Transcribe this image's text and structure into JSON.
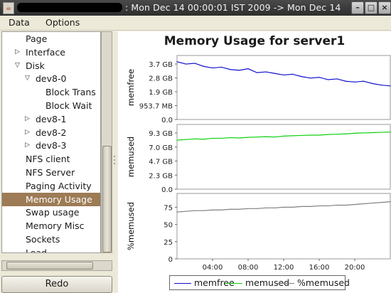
{
  "window": {
    "title": ": Mon Dec 14 00:00:01 IST 2009 -> Mon Dec 14",
    "app_icon": "java-cup-icon",
    "buttons": [
      "minimize-icon",
      "maximize-icon",
      "close-icon"
    ]
  },
  "menu": {
    "items": [
      "Data",
      "Options"
    ]
  },
  "tree": {
    "items": [
      {
        "label": "Page",
        "depth": 1,
        "arrow": ""
      },
      {
        "label": "Interface",
        "depth": 1,
        "arrow": "collapsed"
      },
      {
        "label": "Disk",
        "depth": 1,
        "arrow": "expanded"
      },
      {
        "label": "dev8-0",
        "depth": 2,
        "arrow": "expanded"
      },
      {
        "label": "Block Trans",
        "depth": 3,
        "arrow": ""
      },
      {
        "label": "Block Wait",
        "depth": 3,
        "arrow": ""
      },
      {
        "label": "dev8-1",
        "depth": 2,
        "arrow": "collapsed"
      },
      {
        "label": "dev8-2",
        "depth": 2,
        "arrow": "collapsed"
      },
      {
        "label": "dev8-3",
        "depth": 2,
        "arrow": "collapsed"
      },
      {
        "label": "NFS client",
        "depth": 1,
        "arrow": ""
      },
      {
        "label": "NFS Server",
        "depth": 1,
        "arrow": ""
      },
      {
        "label": "Paging Activity",
        "depth": 1,
        "arrow": ""
      },
      {
        "label": "Memory Usage",
        "depth": 1,
        "arrow": "",
        "selected": true
      },
      {
        "label": "Swap usage",
        "depth": 1,
        "arrow": ""
      },
      {
        "label": "Memory Misc",
        "depth": 1,
        "arrow": ""
      },
      {
        "label": "Sockets",
        "depth": 1,
        "arrow": ""
      },
      {
        "label": "Load",
        "depth": 1,
        "arrow": ""
      }
    ]
  },
  "redo_button": {
    "label": "Redo"
  },
  "chart_data": {
    "type": "line",
    "title": "Memory Usage for server1",
    "x_ticks": [
      "04:00",
      "08:00",
      "12:00",
      "16:00",
      "20:00"
    ],
    "xlim": [
      0,
      24
    ],
    "subplots": [
      {
        "ylabel": "memfree",
        "y_ticks": [
          "3.7 GB",
          "2.8 GB",
          "1.9 GB",
          "953.7 MB",
          "0.0"
        ],
        "ylim": [
          0,
          4.1
        ],
        "series": [
          {
            "name": "memfree",
            "color": "#1010d0",
            "x": [
              0,
              1,
              2,
              3,
              4,
              5,
              6,
              7,
              8,
              9,
              10,
              11,
              12,
              13,
              14,
              15,
              16,
              17,
              18,
              19,
              20,
              21,
              22,
              23,
              24
            ],
            "values": [
              3.7,
              3.55,
              3.6,
              3.4,
              3.3,
              3.35,
              3.2,
              3.15,
              3.25,
              3.0,
              3.05,
              2.95,
              2.85,
              2.9,
              2.75,
              2.65,
              2.7,
              2.55,
              2.6,
              2.45,
              2.4,
              2.45,
              2.3,
              2.2,
              2.15
            ]
          }
        ]
      },
      {
        "ylabel": "memused",
        "y_ticks": [
          "9.3 GB",
          "7.0 GB",
          "4.7 GB",
          "2.3 GB",
          "0.0"
        ],
        "ylim": [
          0,
          10.3
        ],
        "series": [
          {
            "name": "memused",
            "color": "#10d010",
            "x": [
              0,
              1,
              2,
              3,
              4,
              5,
              6,
              7,
              8,
              9,
              10,
              11,
              12,
              13,
              14,
              15,
              16,
              17,
              18,
              19,
              20,
              21,
              22,
              23,
              24
            ],
            "values": [
              7.8,
              7.9,
              8.0,
              7.95,
              8.1,
              8.1,
              8.2,
              8.15,
              8.25,
              8.3,
              8.35,
              8.3,
              8.45,
              8.5,
              8.55,
              8.6,
              8.6,
              8.7,
              8.75,
              8.8,
              8.9,
              8.95,
              9.0,
              9.05,
              9.1
            ]
          }
        ]
      },
      {
        "ylabel": "%memused",
        "y_ticks": [
          "75",
          "50",
          "25",
          "0"
        ],
        "ylim": [
          0,
          95
        ],
        "series": [
          {
            "name": "%memused",
            "color": "#808080",
            "x": [
              0,
              1,
              2,
              3,
              4,
              5,
              6,
              7,
              8,
              9,
              10,
              11,
              12,
              13,
              14,
              15,
              16,
              17,
              18,
              19,
              20,
              21,
              22,
              23,
              24
            ],
            "values": [
              68,
              69,
              70,
              70,
              71,
              71,
              72,
              72,
              73,
              73,
              74,
              74,
              75,
              75,
              76,
              76,
              77,
              77,
              78,
              78,
              79,
              80,
              81,
              82,
              83
            ]
          }
        ]
      }
    ],
    "legend": [
      "memfree",
      "memused",
      "%memused"
    ],
    "legend_colors": [
      "#1010d0",
      "#10d010",
      "#808080"
    ],
    "legend_placement": "bottom"
  }
}
